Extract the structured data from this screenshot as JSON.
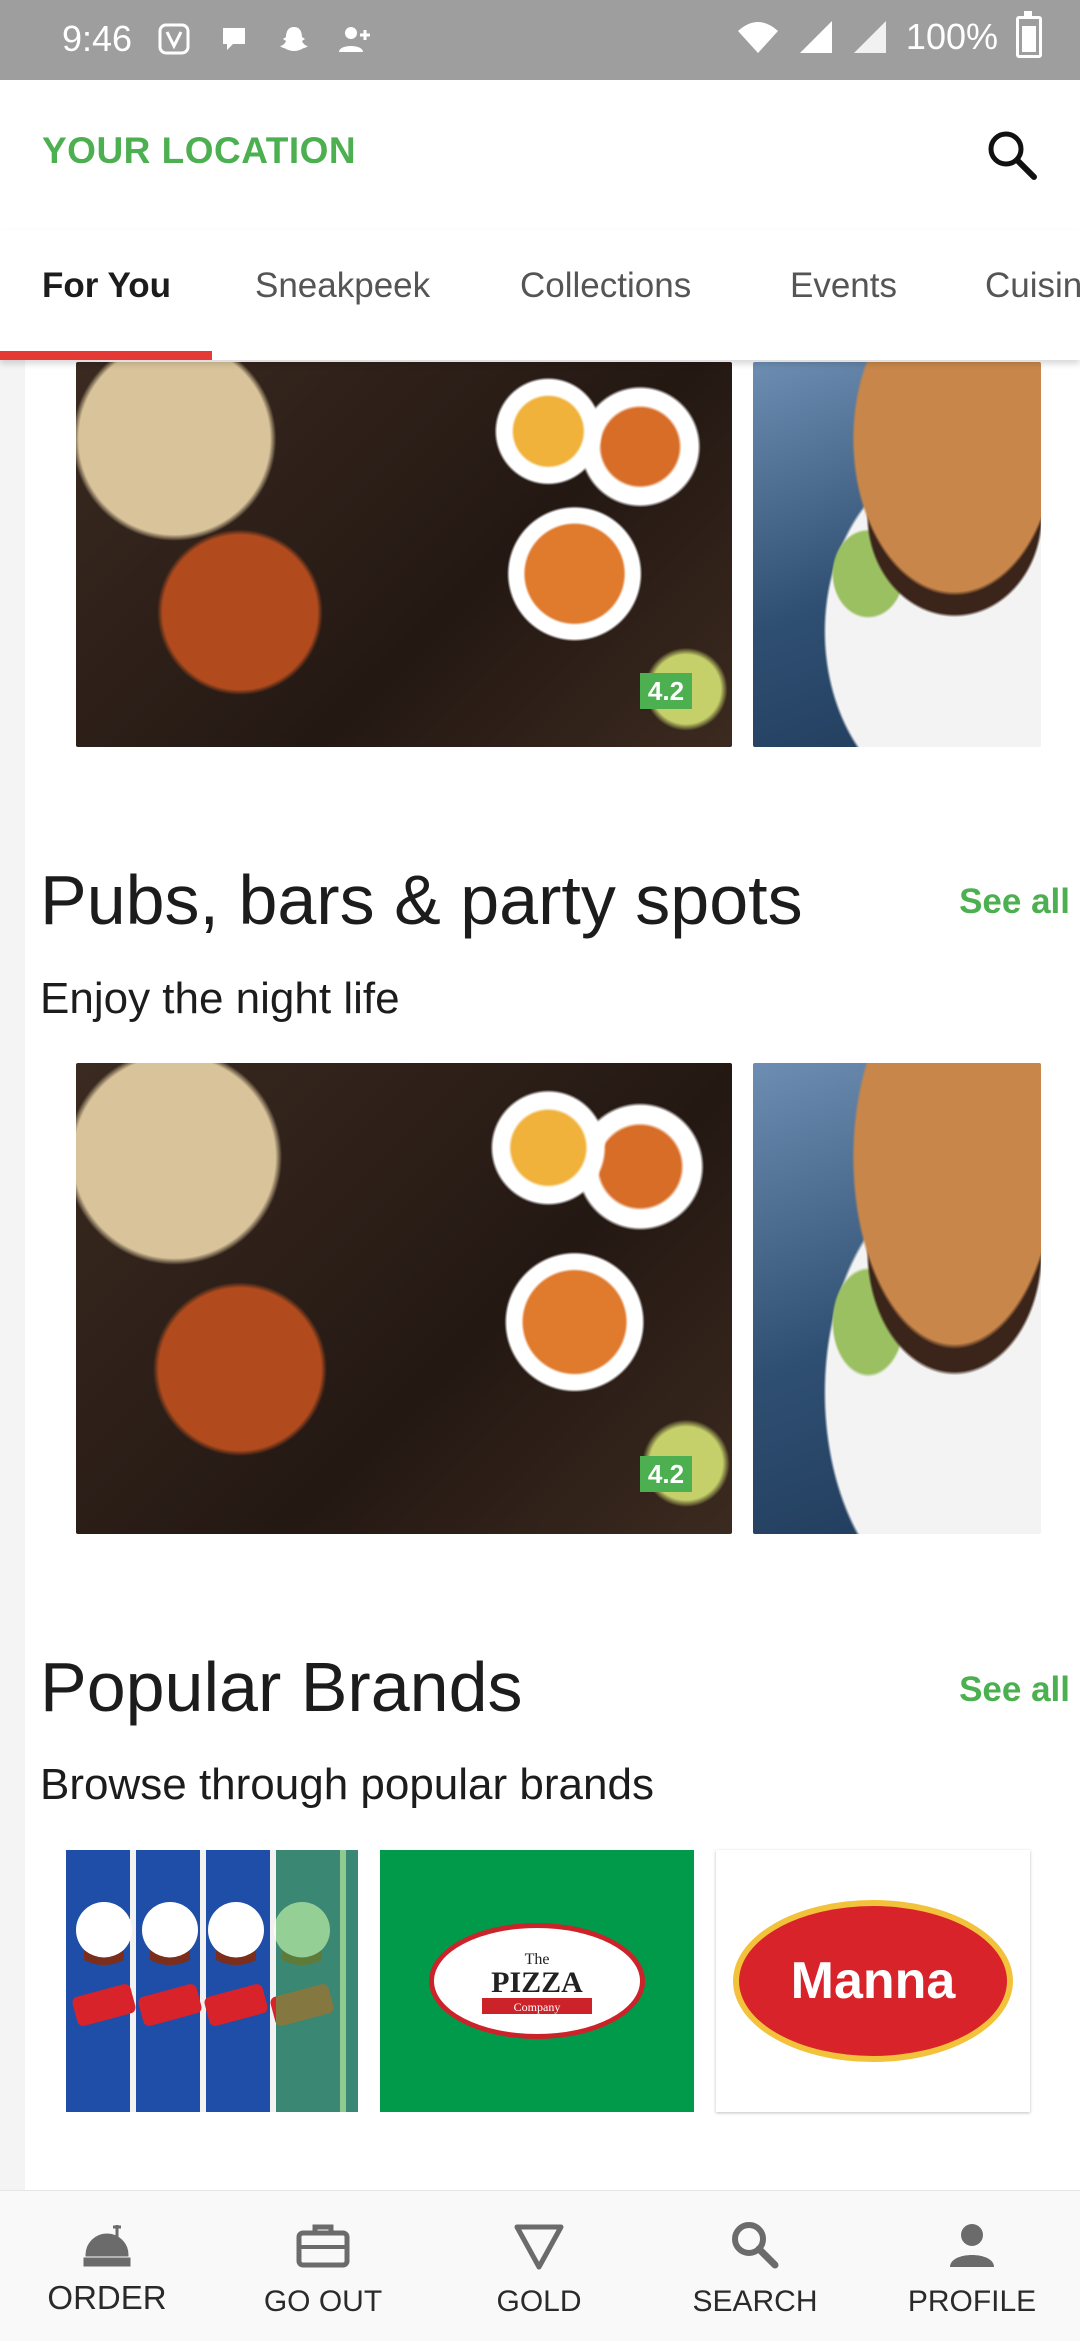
{
  "status_bar": {
    "time": "9:46",
    "battery": "100%"
  },
  "header": {
    "location_label": "YOUR LOCATION"
  },
  "tabs": [
    {
      "label": "For You"
    },
    {
      "label": "Sneakpeek"
    },
    {
      "label": "Collections"
    },
    {
      "label": "Events"
    },
    {
      "label": "Cuisin"
    }
  ],
  "cards_top": {
    "rating": "4.2"
  },
  "section_pubs": {
    "title": "Pubs, bars & party spots",
    "subtitle": "Enjoy the night life",
    "see_all": "See all",
    "rating": "4.2"
  },
  "section_brands": {
    "title": "Popular Brands",
    "subtitle": "Browse through popular brands",
    "see_all": "See all",
    "brands": [
      {
        "name": "Pringles"
      },
      {
        "name": "The Pizza Company"
      },
      {
        "name": "Manna"
      }
    ]
  },
  "bottom_nav": [
    {
      "label": "ORDER",
      "icon": "order-icon"
    },
    {
      "label": "GO OUT",
      "icon": "briefcase-icon"
    },
    {
      "label": "GOLD",
      "icon": "gold-icon"
    },
    {
      "label": "SEARCH",
      "icon": "search-icon"
    },
    {
      "label": "PROFILE",
      "icon": "profile-icon"
    }
  ],
  "colors": {
    "accent_green": "#4caf50",
    "tab_underline": "#e53935",
    "status_bar": "#9e9e9e"
  }
}
